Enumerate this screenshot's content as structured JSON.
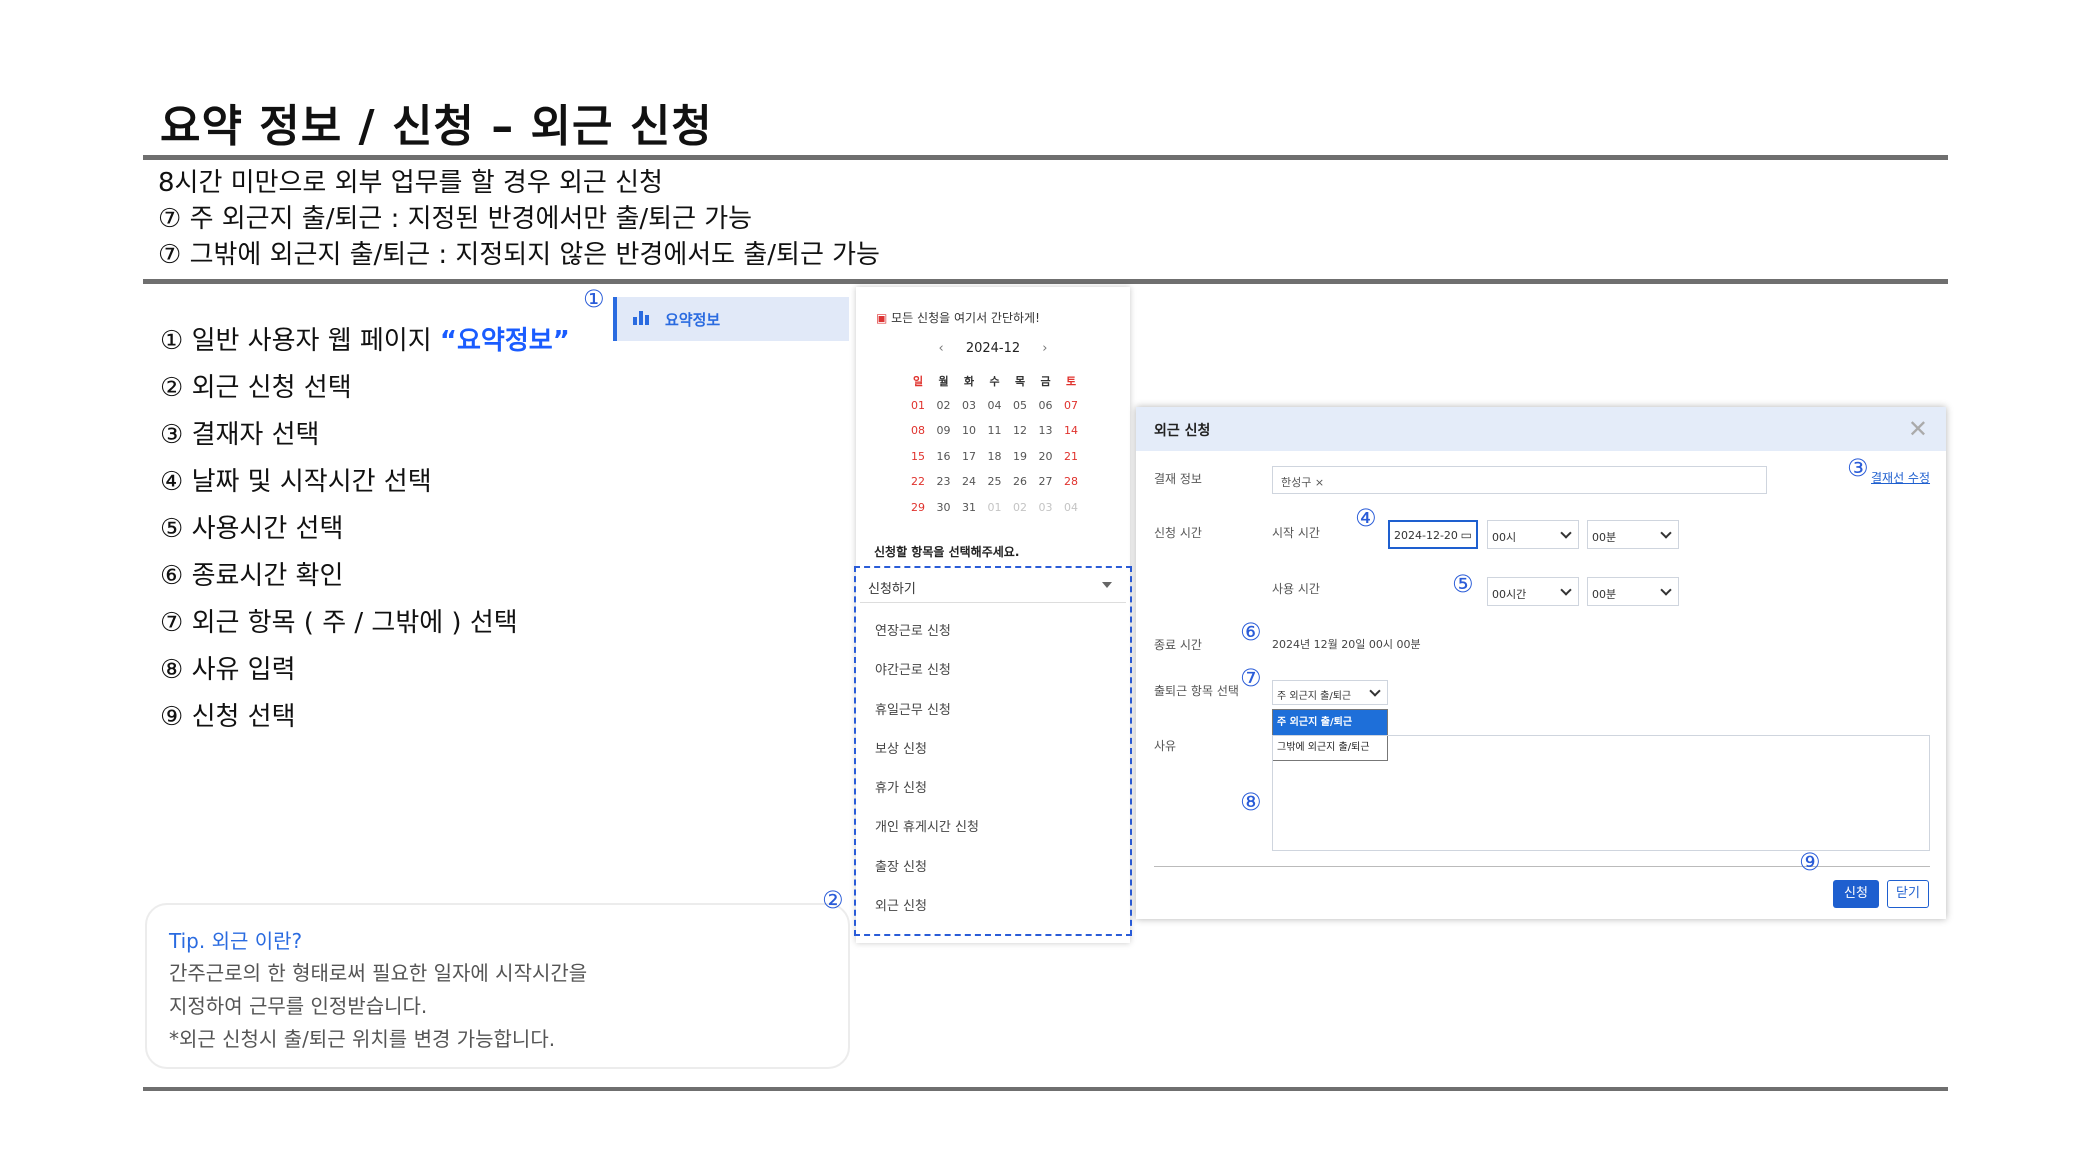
{
  "title": "요약 정보 / 신청 – 외근 신청",
  "description": [
    "8시간 미만으로 외부 업무를 할 경우 외근 신청",
    "⑦ 주 외근지 출/퇴근 : 지정된 반경에서만 출/퇴근 가능",
    "⑦ 그밖에 외근지 출/퇴근 : 지정되지 않은 반경에서도 출/퇴근 가능"
  ],
  "steps": {
    "s1_prefix": "① 일반 사용자 웹 페이지 ",
    "s1_highlight": "“요약정보”",
    "s2": "② 외근 신청 선택",
    "s3": "③ 결재자 선택",
    "s4": "④ 날짜 및 시작시간 선택",
    "s5": "⑤ 사용시간 선택",
    "s6": "⑥ 종료시간 확인",
    "s7": "⑦ 외근 항목 ( 주 / 그밖에 ) 선택",
    "s8": "⑧ 사유 입력",
    "s9": "⑨ 신청 선택"
  },
  "tip": {
    "heading": "Tip. 외근 이란?",
    "lines": [
      "간주근로의 한 형태로써 필요한 일자에 시작시간을",
      "지정하여 근무를 인정받습니다.",
      "*외근 신청시 출/퇴근 위치를 변경 가능합니다."
    ]
  },
  "markers": {
    "m1": "①",
    "m2": "②",
    "m3": "③",
    "m4": "④",
    "m5": "⑤",
    "m6": "⑥",
    "m7": "⑦",
    "m8": "⑧",
    "m9": "⑨"
  },
  "nav": {
    "label": "요약정보",
    "icon": "bar-chart-icon"
  },
  "calendar": {
    "header": "모든 신청을 여기서 간단하게!",
    "month": "2024-12",
    "prev": "‹",
    "next": "›",
    "weekdays": [
      "일",
      "월",
      "화",
      "수",
      "목",
      "금",
      "토"
    ],
    "weeks": [
      [
        "01",
        "02",
        "03",
        "04",
        "05",
        "06",
        "07"
      ],
      [
        "08",
        "09",
        "10",
        "11",
        "12",
        "13",
        "14"
      ],
      [
        "15",
        "16",
        "17",
        "18",
        "19",
        "20",
        "21"
      ],
      [
        "22",
        "23",
        "24",
        "25",
        "26",
        "27",
        "28"
      ],
      [
        "29",
        "30",
        "31",
        "01",
        "02",
        "03",
        "04"
      ]
    ],
    "prompt": "신청할 항목을 선택해주세요.",
    "select_value": "신청하기",
    "options": [
      "연장근로 신청",
      "야간근로 신청",
      "휴일근무 신청",
      "보상 신청",
      "휴가 신청",
      "개인 휴게시간 신청",
      "출장 신청",
      "외근 신청"
    ]
  },
  "form": {
    "title": "외근 신청",
    "approver_label": "결재 정보",
    "approver_chip": "한성구 ×",
    "approver_link": "결재선 수정",
    "time_label": "신청 시간",
    "start_label": "시작 시간",
    "start_date": "2024-12-20",
    "start_hour": "00시",
    "start_min": "00분",
    "use_label": "사용 시간",
    "use_hour": "00시간",
    "use_min": "00분",
    "end_label": "종료 시간",
    "end_value": "2024년 12월 20일 00시 00분",
    "item_label": "출퇴근 항목 선택",
    "item_value": "주 외근지 출/퇴근",
    "item_options": [
      "주 외근지 출/퇴근",
      "그밖에 외근지 출/퇴근"
    ],
    "reason_label": "사유",
    "submit": "신청",
    "close": "닫기"
  }
}
